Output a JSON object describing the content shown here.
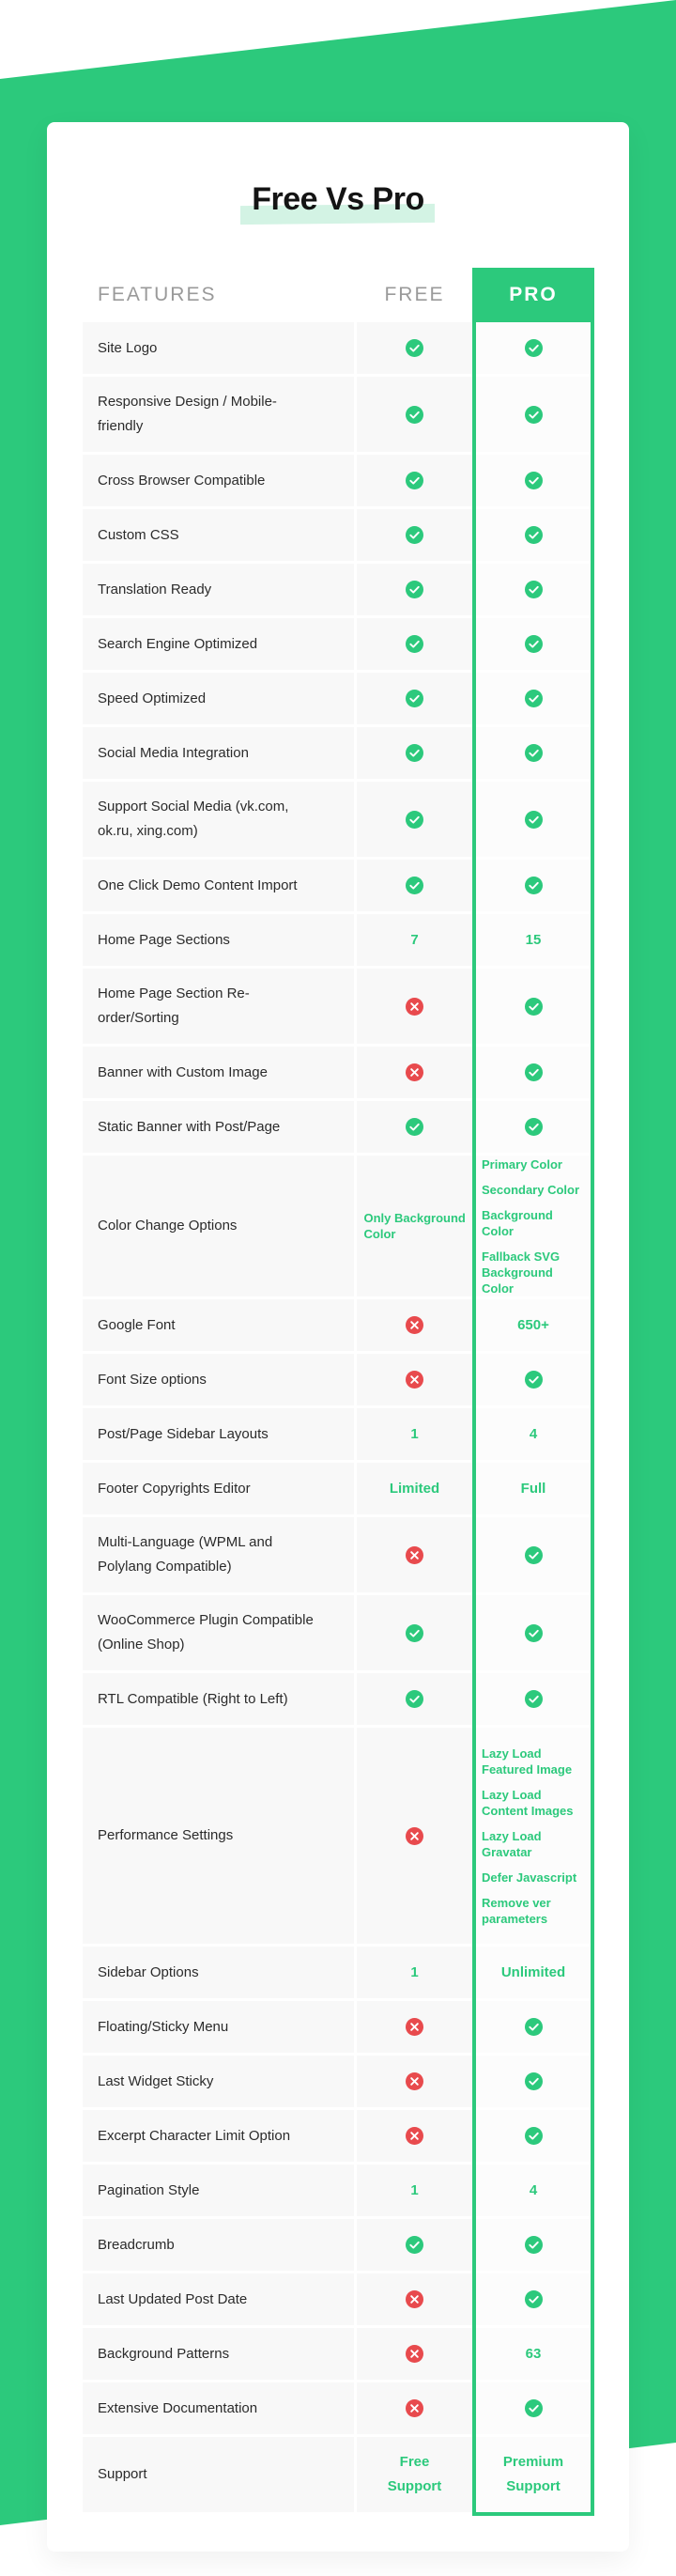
{
  "colors": {
    "accent": "#2cc97c",
    "negative": "#e84a4d",
    "highlight": "#d3f3e4"
  },
  "title": "Free Vs Pro",
  "header": {
    "features": "FEATURES",
    "free": "FREE",
    "pro": "PRO"
  },
  "rows": [
    {
      "feature": "Site Logo",
      "free": {
        "type": "check"
      },
      "pro": {
        "type": "check"
      }
    },
    {
      "feature": "Responsive Design / Mobile-friendly",
      "free": {
        "type": "check"
      },
      "pro": {
        "type": "check"
      }
    },
    {
      "feature": "Cross Browser Compatible",
      "free": {
        "type": "check"
      },
      "pro": {
        "type": "check"
      }
    },
    {
      "feature": "Custom CSS",
      "free": {
        "type": "check"
      },
      "pro": {
        "type": "check"
      }
    },
    {
      "feature": "Translation Ready",
      "free": {
        "type": "check"
      },
      "pro": {
        "type": "check"
      }
    },
    {
      "feature": "Search Engine Optimized",
      "free": {
        "type": "check"
      },
      "pro": {
        "type": "check"
      }
    },
    {
      "feature": "Speed Optimized",
      "free": {
        "type": "check"
      },
      "pro": {
        "type": "check"
      }
    },
    {
      "feature": "Social Media Integration",
      "free": {
        "type": "check"
      },
      "pro": {
        "type": "check"
      }
    },
    {
      "feature": "Support Social Media (vk.com, ok.ru, xing.com)",
      "free": {
        "type": "check"
      },
      "pro": {
        "type": "check"
      }
    },
    {
      "feature": "One Click Demo Content Import",
      "free": {
        "type": "check"
      },
      "pro": {
        "type": "check"
      }
    },
    {
      "feature": "Home Page Sections",
      "free": {
        "type": "text",
        "text": "7"
      },
      "pro": {
        "type": "text",
        "text": "15"
      }
    },
    {
      "feature": "Home Page Section Re-order/Sorting",
      "free": {
        "type": "cross"
      },
      "pro": {
        "type": "check"
      }
    },
    {
      "feature": "Banner with Custom Image",
      "free": {
        "type": "cross"
      },
      "pro": {
        "type": "check"
      }
    },
    {
      "feature": "Static Banner with Post/Page",
      "free": {
        "type": "check"
      },
      "pro": {
        "type": "check"
      }
    },
    {
      "feature": "Color Change Options",
      "free": {
        "type": "text",
        "text": "Only Background Color"
      },
      "pro": {
        "type": "list",
        "items": [
          "Primary Color",
          "Secondary Color",
          "Background Color",
          "Fallback SVG Background Color"
        ]
      }
    },
    {
      "feature": "Google Font",
      "free": {
        "type": "cross"
      },
      "pro": {
        "type": "text",
        "text": "650+"
      }
    },
    {
      "feature": "Font Size options",
      "free": {
        "type": "cross"
      },
      "pro": {
        "type": "check"
      }
    },
    {
      "feature": "Post/Page Sidebar Layouts",
      "free": {
        "type": "text",
        "text": "1"
      },
      "pro": {
        "type": "text",
        "text": "4"
      }
    },
    {
      "feature": "Footer Copyrights Editor",
      "free": {
        "type": "text",
        "text": "Limited"
      },
      "pro": {
        "type": "text",
        "text": "Full"
      }
    },
    {
      "feature": "Multi-Language (WPML and Polylang Compatible)",
      "free": {
        "type": "cross"
      },
      "pro": {
        "type": "check"
      }
    },
    {
      "feature": "WooCommerce Plugin Compatible (Online Shop)",
      "free": {
        "type": "check"
      },
      "pro": {
        "type": "check"
      }
    },
    {
      "feature": "RTL Compatible (Right to Left)",
      "free": {
        "type": "check"
      },
      "pro": {
        "type": "check"
      }
    },
    {
      "feature": "Performance Settings",
      "free": {
        "type": "cross"
      },
      "pro": {
        "type": "list",
        "items": [
          "Lazy Load Featured Image",
          "Lazy Load Content Images",
          "Lazy Load Gravatar",
          "Defer Javascript",
          "Remove ver parameters"
        ]
      }
    },
    {
      "feature": "Sidebar Options",
      "free": {
        "type": "text",
        "text": "1"
      },
      "pro": {
        "type": "text",
        "text": "Unlimited"
      }
    },
    {
      "feature": "Floating/Sticky Menu",
      "free": {
        "type": "cross"
      },
      "pro": {
        "type": "check"
      }
    },
    {
      "feature": "Last Widget Sticky",
      "free": {
        "type": "cross"
      },
      "pro": {
        "type": "check"
      }
    },
    {
      "feature": "Excerpt Character Limit Option",
      "free": {
        "type": "cross"
      },
      "pro": {
        "type": "check"
      }
    },
    {
      "feature": "Pagination Style",
      "free": {
        "type": "text",
        "text": "1"
      },
      "pro": {
        "type": "text",
        "text": "4"
      }
    },
    {
      "feature": "Breadcrumb",
      "free": {
        "type": "check"
      },
      "pro": {
        "type": "check"
      }
    },
    {
      "feature": "Last Updated Post Date",
      "free": {
        "type": "cross"
      },
      "pro": {
        "type": "check"
      }
    },
    {
      "feature": "Background Patterns",
      "free": {
        "type": "cross"
      },
      "pro": {
        "type": "text",
        "text": "63"
      }
    },
    {
      "feature": "Extensive Documentation",
      "free": {
        "type": "cross"
      },
      "pro": {
        "type": "check"
      }
    },
    {
      "feature": "Support",
      "free": {
        "type": "text",
        "text": "Free Support"
      },
      "pro": {
        "type": "text",
        "text": "Premium Support"
      }
    }
  ]
}
